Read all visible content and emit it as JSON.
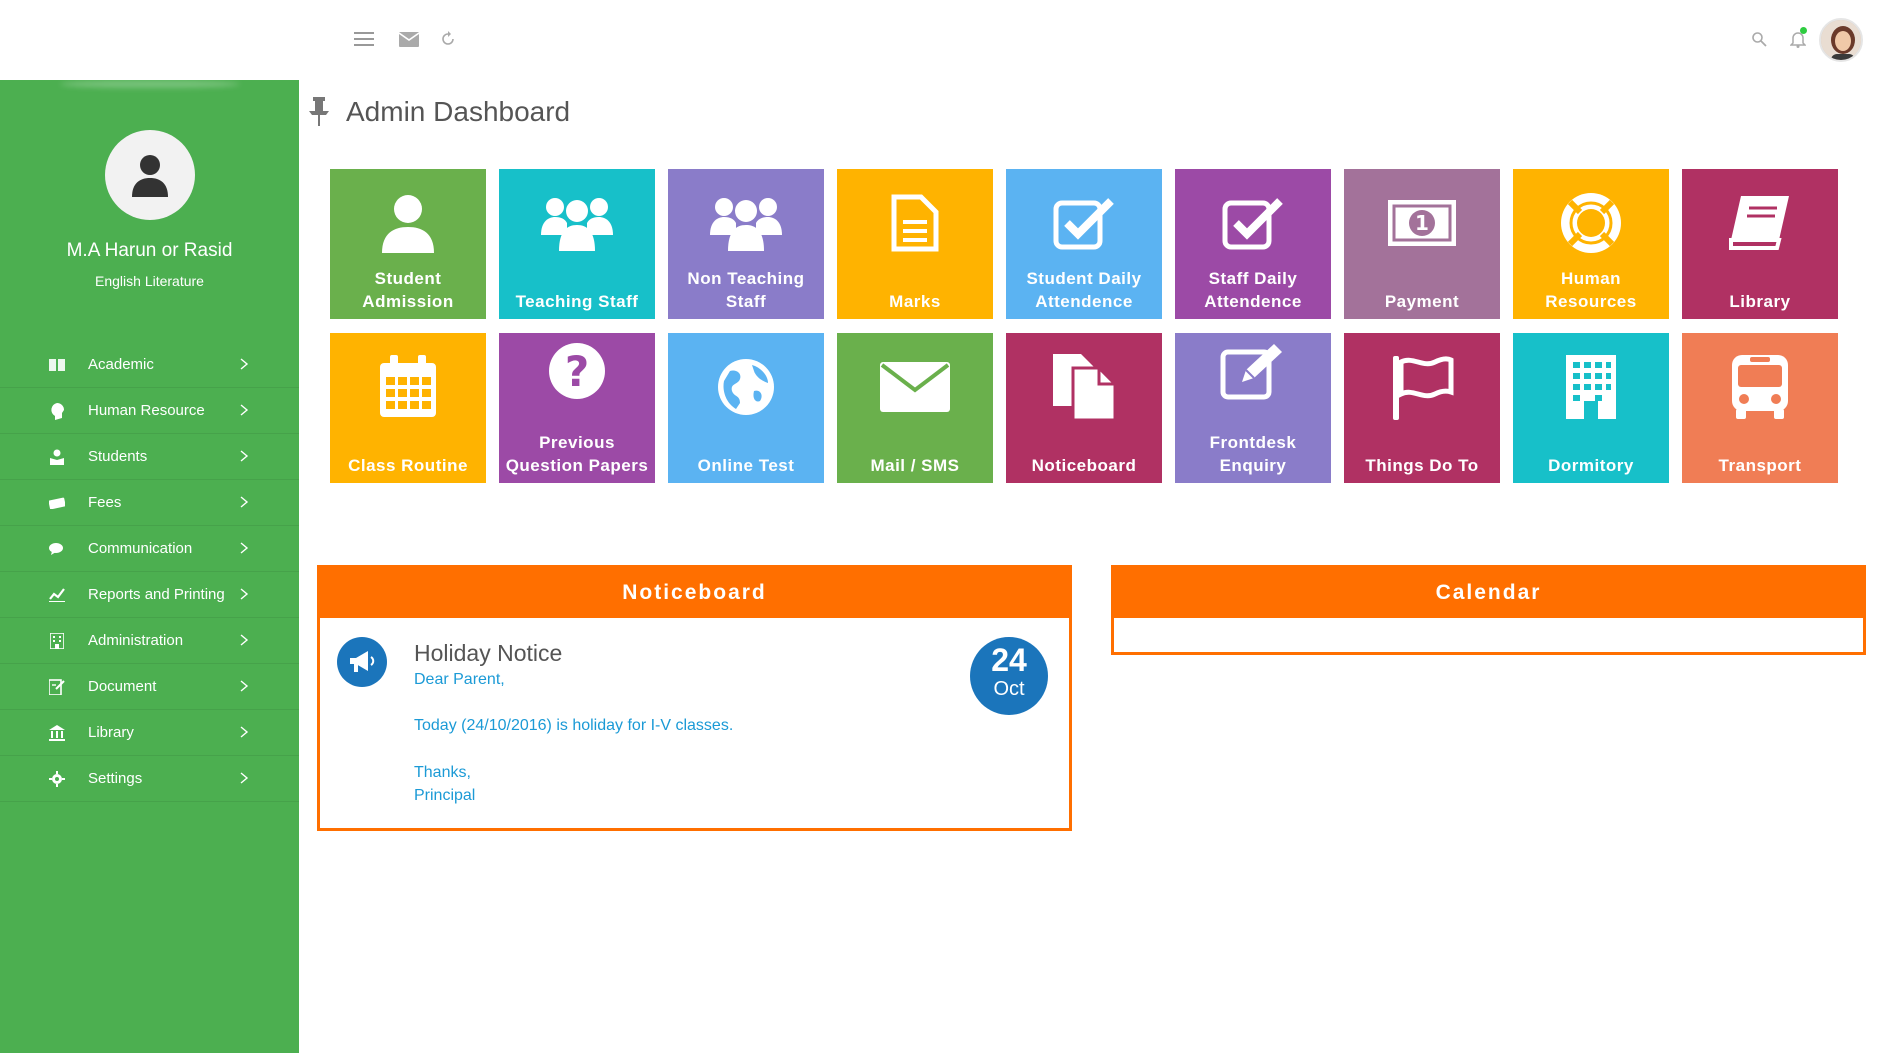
{
  "topbar": {
    "icons": [
      "menu-icon",
      "mail-icon",
      "refresh-icon",
      "search-icon",
      "bell-icon",
      "user-avatar"
    ]
  },
  "sidebar": {
    "user_name": "M.A Harun or Rasid",
    "user_subject": "English Literature",
    "items": [
      {
        "label": "Academic",
        "icon": "book-icon"
      },
      {
        "label": "Human Resource",
        "icon": "head-icon"
      },
      {
        "label": "Students",
        "icon": "student-icon"
      },
      {
        "label": "Fees",
        "icon": "money-icon"
      },
      {
        "label": "Communication",
        "icon": "chat-icon"
      },
      {
        "label": "Reports and Printing",
        "icon": "chart-icon"
      },
      {
        "label": "Administration",
        "icon": "building-icon"
      },
      {
        "label": "Document",
        "icon": "document-icon"
      },
      {
        "label": "Library",
        "icon": "institution-icon"
      },
      {
        "label": "Settings",
        "icon": "gear-icon"
      }
    ]
  },
  "main": {
    "title": "Admin Dashboard",
    "tiles_row1": [
      {
        "label": "Student Admission",
        "color": "#6ab04c",
        "icon": "user-icon"
      },
      {
        "label": "Teaching Staff",
        "color": "#17c0c9",
        "icon": "group-icon"
      },
      {
        "label": "Non Teaching Staff",
        "color": "#8a7cc9",
        "icon": "group-icon"
      },
      {
        "label": "Marks",
        "color": "#ffb300",
        "icon": "file-icon"
      },
      {
        "label": "Student Daily Attendence",
        "color": "#5bb3f2",
        "icon": "checkbox-icon"
      },
      {
        "label": "Staff Daily Attendence",
        "color": "#9c4aa6",
        "icon": "checkbox-icon"
      },
      {
        "label": "Payment",
        "color": "#a3729a",
        "icon": "money-bill-icon"
      },
      {
        "label": "Human Resources",
        "color": "#ffb300",
        "icon": "lifebuoy-icon"
      },
      {
        "label": "Library",
        "color": "#b03163",
        "icon": "library-book-icon"
      }
    ],
    "tiles_row2": [
      {
        "label": "Class Routine",
        "color": "#ffb300",
        "icon": "calendar-icon"
      },
      {
        "label": "Previous Question Papers",
        "color": "#9c4aa6",
        "icon": "question-icon"
      },
      {
        "label": "Online Test",
        "color": "#5bb3f2",
        "icon": "globe-icon"
      },
      {
        "label": "Mail / SMS",
        "color": "#6ab04c",
        "icon": "envelope-icon"
      },
      {
        "label": "Noticeboard",
        "color": "#b03163",
        "icon": "documents-icon"
      },
      {
        "label": "Frontdesk Enquiry",
        "color": "#8a7cc9",
        "icon": "edit-icon"
      },
      {
        "label": "Things Do To",
        "color": "#b03163",
        "icon": "flag-icon"
      },
      {
        "label": "Dormitory",
        "color": "#17c0c9",
        "icon": "building-icon"
      },
      {
        "label": "Transport",
        "color": "#f07d55",
        "icon": "bus-icon"
      }
    ]
  },
  "noticeboard": {
    "title": "Noticeboard",
    "notice_title": "Holiday Notice",
    "line1": "Dear Parent,",
    "line2": "Today (24/10/2016) is holiday for I-V classes.",
    "line3": "Thanks,",
    "line4": "Principal",
    "date_day": "24",
    "date_month": "Oct"
  },
  "calendar": {
    "title": "Calendar"
  },
  "colors": {
    "sidebar": "#4caf50",
    "panel_accent": "#ff6f00",
    "badge_blue": "#1b75bb",
    "notice_text": "#1b9ad6"
  }
}
